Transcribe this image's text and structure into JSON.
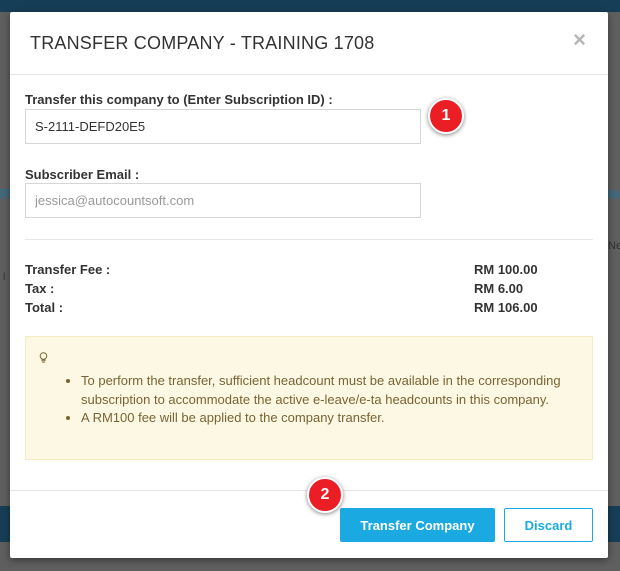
{
  "modal": {
    "title": "TRANSFER COMPANY - TRAINING 1708",
    "close_glyph": "×",
    "subscription_field": {
      "label": "Transfer this company to (Enter Subscription ID) :",
      "value": "S-2111-DEFD20E5"
    },
    "email_field": {
      "label": "Subscriber Email :",
      "placeholder": "jessica@autocountsoft.com"
    },
    "fees": [
      {
        "label": "Transfer Fee :",
        "value": "RM 100.00"
      },
      {
        "label": "Tax :",
        "value": "RM 6.00"
      },
      {
        "label": "Total :",
        "value": "RM 106.00"
      }
    ],
    "note": {
      "icon": "lightbulb-icon",
      "items": [
        "To perform the transfer, sufficient headcount must be available in the corresponding subscription to accommodate the active e-leave/e-ta headcounts in this company.",
        "A RM100 fee will be applied to the company transfer."
      ]
    },
    "buttons": {
      "transfer_label": "Transfer Company",
      "discard_label": "Discard"
    }
  },
  "step_badges": [
    "1",
    "2"
  ],
  "background": {
    "left_text": "R",
    "left_text2": "l",
    "right_text": "NC",
    "right_text2": "Ne"
  },
  "colors": {
    "accent": "#1ba9e1",
    "badge": "#ea1e24",
    "note_bg": "#fdf8e4",
    "note_text": "#7a6334",
    "app_bar": "#163f57"
  }
}
